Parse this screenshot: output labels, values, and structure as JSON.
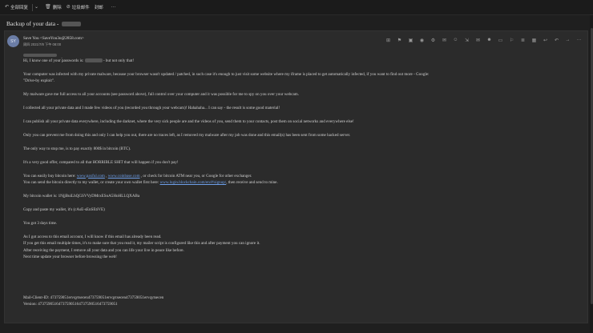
{
  "toolbar": {
    "reply_all": "全部回复",
    "delete": "删除",
    "report": "垃圾邮件",
    "archive": "封邮",
    "more": "···"
  },
  "subject": "Backup of your data -",
  "message": {
    "avatar_initials": "SY",
    "sender": "Save You <SaveYou3o@2858.com>",
    "date": "周四 2021/7/8 下午 08:00",
    "more_icon": "···",
    "lines": [
      {
        "t": "Hi, I know one of your passwords is: "
      },
      {
        "t": " - but not only that!"
      },
      {
        "t": "Your computer was infected with my private malware, because your browser wasn't updated / patched, in such case it's enough to just visit some website where my iframe is placed to get automatically infected, if you want to find out more - Google:"
      },
      {
        "t": "\"Drive-by exploit\"."
      },
      {
        "t": "My malware gave me full access to all your accounts (see password above), full control over your computer and it was possible for me to spy on you over your webcam."
      },
      {
        "t": "I collected all your private data and I made few videos of you (recorded you through your webcam)! Hahahaha... I can say - the result is some good material!"
      },
      {
        "t": "I can publish all your private data everywhere, including the darknet, where the very sick people are and the videos of you, send them to your contacts, post them on social networks and everywhere else!"
      },
      {
        "t": "Only you can prevent me from doing this and only I can help you out, there are no traces left, as I removed my malware after my job was done and this email(s) has been sent from some hacked server."
      },
      {
        "t": "The only way to stop me, is to pay exactly 800$ in bitcoin (BTC)."
      },
      {
        "t": "It's a very good offer, compared to all that HORRIBLE SHIT that will happen if you don't pay!"
      },
      {
        "t": "You can easily buy bitcoin here: "
      },
      {
        "t": "www.paxful.com"
      },
      {
        "t": " , "
      },
      {
        "t": "www.coinbase.com"
      },
      {
        "t": " , or check for bitcoin ATM near you, or Google for other exchanger."
      },
      {
        "t": "You can send the bitcoin directly to my wallet, or create your own wallet first here: "
      },
      {
        "t": "www.login.blockchain.com/en/#/signup/"
      },
      {
        "t": ", then receive and send to mine."
      },
      {
        "t": "My bitcoin wallet is: 1NjjBuiLhQGSVVyDMrxESoA5HoHLLQXABa"
      },
      {
        "t": "Copy and paste my wallet, it's (cAsE-sEnSEtiVE)"
      },
      {
        "t": "You got 3 days time."
      },
      {
        "t": "As I got access to this email account, I will know if this email has already been read."
      },
      {
        "t": "If you get this email multiple times, it's to make sure that you read it, my mailer script is configured like this and after payment you can ignore it."
      },
      {
        "t": "After receiving the payment, I remove all your data and you can life your live in peace like before."
      },
      {
        "t": "Next time update your browser before browsing the web!"
      },
      {
        "t": "Mail-Client-ID: 473759051ervqytsecen473759051ervqytsecen473759051ervqytsecen"
      },
      {
        "t": "Version: 473759051647375905164737590516473759051"
      }
    ]
  }
}
